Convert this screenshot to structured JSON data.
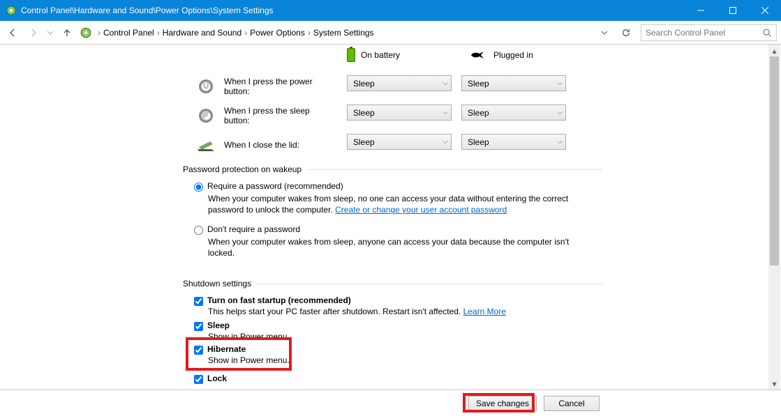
{
  "window": {
    "title": "Control Panel\\Hardware and Sound\\Power Options\\System Settings"
  },
  "breadcrumb": {
    "items": [
      "Control Panel",
      "Hardware and Sound",
      "Power Options",
      "System Settings"
    ]
  },
  "search": {
    "placeholder": "Search Control Panel"
  },
  "columns": {
    "battery": "On battery",
    "plugged": "Plugged in"
  },
  "actions": {
    "power": {
      "label": "When I press the power button:",
      "battery": "Sleep",
      "plugged": "Sleep"
    },
    "sleep": {
      "label": "When I press the sleep button:",
      "battery": "Sleep",
      "plugged": "Sleep"
    },
    "lid": {
      "label": "When I close the lid:",
      "battery": "Sleep",
      "plugged": "Sleep"
    }
  },
  "password_section": {
    "title": "Password protection on wakeup",
    "require": {
      "label": "Require a password (recommended)",
      "desc": "When your computer wakes from sleep, no one can access your data without entering the correct password to unlock the computer.",
      "link": "Create or change your user account password",
      "checked": true
    },
    "dont_require": {
      "label": "Don't require a password",
      "desc": "When your computer wakes from sleep, anyone can access your data because the computer isn't locked.",
      "checked": false
    }
  },
  "shutdown_section": {
    "title": "Shutdown settings",
    "fast_startup": {
      "label": "Turn on fast startup (recommended)",
      "desc": "This helps start your PC faster after shutdown. Restart isn't affected.",
      "link": "Learn More",
      "checked": true
    },
    "sleep": {
      "label": "Sleep",
      "desc": "Show in Power menu.",
      "checked": true
    },
    "hibernate": {
      "label": "Hibernate",
      "desc": "Show in Power menu.",
      "checked": true
    },
    "lock": {
      "label": "Lock",
      "checked": true
    }
  },
  "footer": {
    "save": "Save changes",
    "cancel": "Cancel"
  }
}
